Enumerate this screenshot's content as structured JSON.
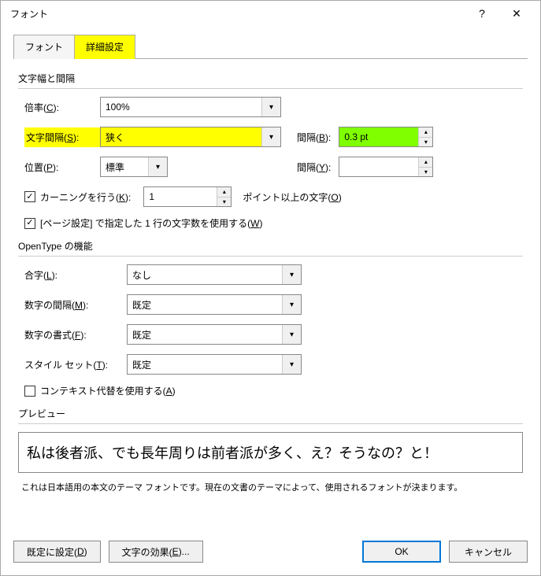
{
  "window": {
    "title": "フォント",
    "help": "?",
    "close": "✕"
  },
  "tabs": {
    "font": "フォント",
    "advanced": "詳細設定"
  },
  "group1": {
    "title": "文字幅と間隔",
    "scale": {
      "label": "倍率(",
      "key": "C",
      "tail": "):",
      "value": "100%"
    },
    "spacing": {
      "label": "文字間隔(",
      "key": "S",
      "tail": "):",
      "value": "狭く",
      "by_label": "間隔(",
      "by_key": "B",
      "by_tail": "):",
      "by_value": "0.3 pt"
    },
    "position": {
      "label": "位置(",
      "key": "P",
      "tail": "):",
      "value": "標準",
      "by_label": "間隔(",
      "by_key": "Y",
      "by_tail": "):",
      "by_value": ""
    },
    "kerning": {
      "label": "カーニングを行う(",
      "key": "K",
      "tail": "):",
      "value": "1",
      "suffix_label": "ポイント以上の文字(",
      "suffix_key": "O",
      "suffix_tail": ")"
    },
    "grid": {
      "label_a": "[ページ設定] で指定した 1 行の文字数を使用する(",
      "key": "W",
      "tail": ")"
    }
  },
  "group2": {
    "title": "OpenType の機能",
    "ligatures": {
      "label": "合字(",
      "key": "L",
      "tail": "):",
      "value": "なし"
    },
    "num_spacing": {
      "label": "数字の間隔(",
      "key": "M",
      "tail": "):",
      "value": "既定"
    },
    "num_forms": {
      "label": "数字の書式(",
      "key": "F",
      "tail": "):",
      "value": "既定"
    },
    "style_set": {
      "label": "スタイル セット(",
      "key": "T",
      "tail": "):",
      "value": "既定"
    },
    "context": {
      "label": "コンテキスト代替を使用する(",
      "key": "A",
      "tail": ")"
    }
  },
  "preview": {
    "title": "プレビュー",
    "text": "私は後者派、でも長年周りは前者派が多く、え？そうなの？と！",
    "note": "これは日本語用の本文のテーマ フォントです。現在の文書のテーマによって、使用されるフォントが決まります。"
  },
  "footer": {
    "default": {
      "label": "既定に設定(",
      "key": "D",
      "tail": ")"
    },
    "effects": {
      "label": "文字の効果(",
      "key": "E",
      "tail": ")..."
    },
    "ok": "OK",
    "cancel": "キャンセル"
  }
}
